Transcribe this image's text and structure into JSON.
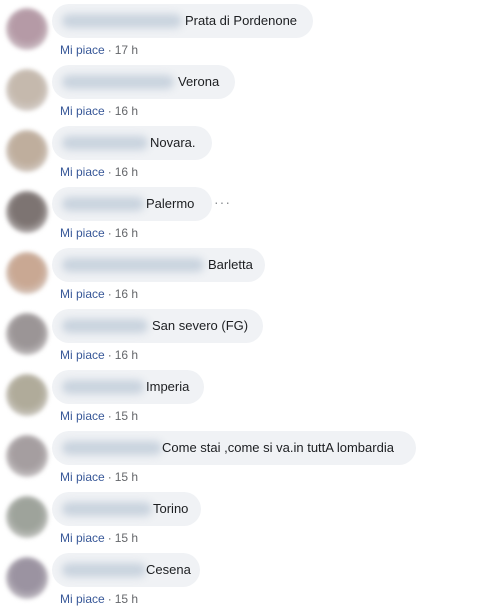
{
  "like_label": "Mi piace",
  "separator": "·",
  "more_icon": "···",
  "comments": [
    {
      "text": "Prata di Pordenone",
      "time": "17 h",
      "avatar_color": "#b59aa6"
    },
    {
      "text": "Verona",
      "time": "16 h",
      "avatar_color": "#c5b9ad"
    },
    {
      "text": "Novara.",
      "time": "16 h",
      "avatar_color": "#bfae9d"
    },
    {
      "text": "Palermo",
      "time": "16 h",
      "avatar_color": "#7d7472"
    },
    {
      "text": "Barletta",
      "time": "16 h",
      "avatar_color": "#c9a893"
    },
    {
      "text": "San severo (FG)",
      "time": "16 h",
      "avatar_color": "#9b9596"
    },
    {
      "text": "Imperia",
      "time": "15 h",
      "avatar_color": "#b0ab9a"
    },
    {
      "text": "Come stai ,come si va.in tuttA lombardia",
      "time": "15 h",
      "avatar_color": "#a59ea0"
    },
    {
      "text": "Torino",
      "time": "15 h",
      "avatar_color": "#9ea39b"
    },
    {
      "text": "Cesena",
      "time": "15 h",
      "avatar_color": "#9b93a1"
    }
  ]
}
